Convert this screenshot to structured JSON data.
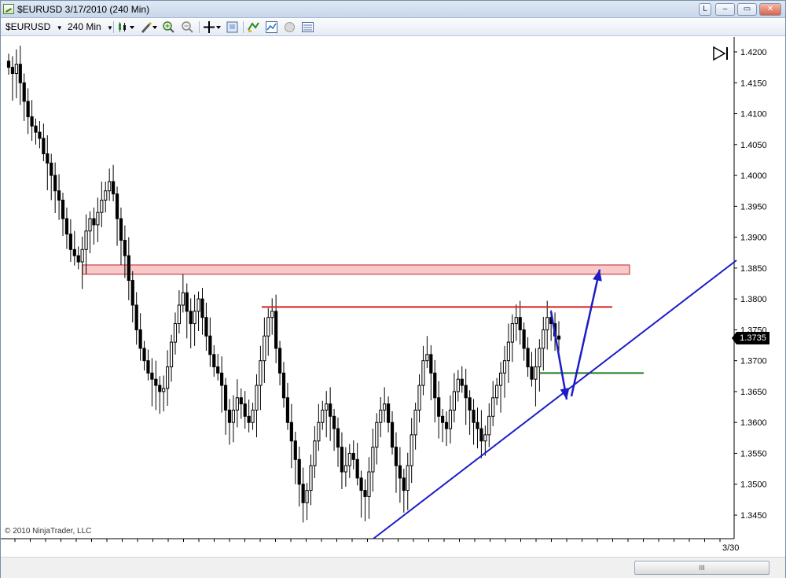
{
  "window": {
    "title": "$EURUSD  3/17/2010 (240 Min)",
    "controls": {
      "pin_label": "L",
      "minimize_label": "–",
      "maximize_label": "▭",
      "close_label": "✕"
    }
  },
  "toolbar": {
    "instrument": "$EURUSD",
    "interval": "240 Min"
  },
  "chart": {
    "copyright": "© 2010 NinjaTrader, LLC",
    "last_price": "1.3735",
    "date_label": "3/30",
    "scroll_grip": "III",
    "price_labels": [
      "1.4200",
      "1.4150",
      "1.4100",
      "1.4050",
      "1.4000",
      "1.3950",
      "1.3900",
      "1.3850",
      "1.3800",
      "1.3750",
      "1.3700",
      "1.3650",
      "1.3600",
      "1.3550",
      "1.3500",
      "1.3450"
    ],
    "colors": {
      "candle": "#000000",
      "resistance_zone_fill": "#f9c8c8",
      "resistance_zone_border": "#c0262b",
      "resistance_line": "#d61f1f",
      "support_line": "#1b7a1b",
      "trendline": "#1c1cc8",
      "projection_arrow": "#1c1cc8"
    }
  },
  "chart_data": {
    "type": "candlestick",
    "ylim": [
      1.3415,
      1.423
    ],
    "ticks": [
      1.42,
      1.415,
      1.41,
      1.405,
      1.4,
      1.395,
      1.39,
      1.385,
      1.38,
      1.375,
      1.37,
      1.365,
      1.36,
      1.355,
      1.35,
      1.345
    ],
    "x_tick_label": "3/30",
    "close_path": [
      1.4175,
      1.4165,
      1.418,
      1.415,
      1.412,
      1.4095,
      1.408,
      1.407,
      1.406,
      1.4035,
      1.402,
      1.4,
      1.3975,
      1.396,
      1.393,
      1.3905,
      1.388,
      1.387,
      1.386,
      1.388,
      1.391,
      1.393,
      1.392,
      1.394,
      1.396,
      1.3975,
      1.399,
      1.397,
      1.393,
      1.3895,
      1.387,
      1.383,
      1.379,
      1.375,
      1.372,
      1.37,
      1.368,
      1.367,
      1.366,
      1.365,
      1.3655,
      1.369,
      1.373,
      1.376,
      1.379,
      1.381,
      1.378,
      1.376,
      1.378,
      1.38,
      1.377,
      1.374,
      1.371,
      1.369,
      1.368,
      1.366,
      1.362,
      1.36,
      1.362,
      1.364,
      1.363,
      1.361,
      1.36,
      1.362,
      1.366,
      1.37,
      1.374,
      1.377,
      1.378,
      1.372,
      1.368,
      1.364,
      1.36,
      1.357,
      1.354,
      1.35,
      1.347,
      1.349,
      1.353,
      1.357,
      1.36,
      1.362,
      1.363,
      1.361,
      1.359,
      1.356,
      1.352,
      1.353,
      1.355,
      1.354,
      1.351,
      1.349,
      1.348,
      1.352,
      1.356,
      1.36,
      1.362,
      1.363,
      1.36,
      1.356,
      1.353,
      1.351,
      1.349,
      1.353,
      1.358,
      1.362,
      1.366,
      1.37,
      1.371,
      1.368,
      1.364,
      1.361,
      1.36,
      1.359,
      1.362,
      1.365,
      1.367,
      1.366,
      1.364,
      1.362,
      1.36,
      1.359,
      1.357,
      1.358,
      1.361,
      1.364,
      1.366,
      1.368,
      1.37,
      1.373,
      1.376,
      1.377,
      1.375,
      1.372,
      1.369,
      1.367,
      1.369,
      1.372,
      1.375,
      1.377,
      1.376,
      1.374,
      1.3735
    ],
    "resistance_zone": {
      "ymin": 1.384,
      "ymax": 1.3855
    },
    "resistance_line": 1.3787,
    "support_line": 1.368,
    "trendline": {
      "from_price": 1.342,
      "to_price": 1.386
    },
    "projection": [
      1.378,
      1.3655,
      1.384
    ]
  }
}
